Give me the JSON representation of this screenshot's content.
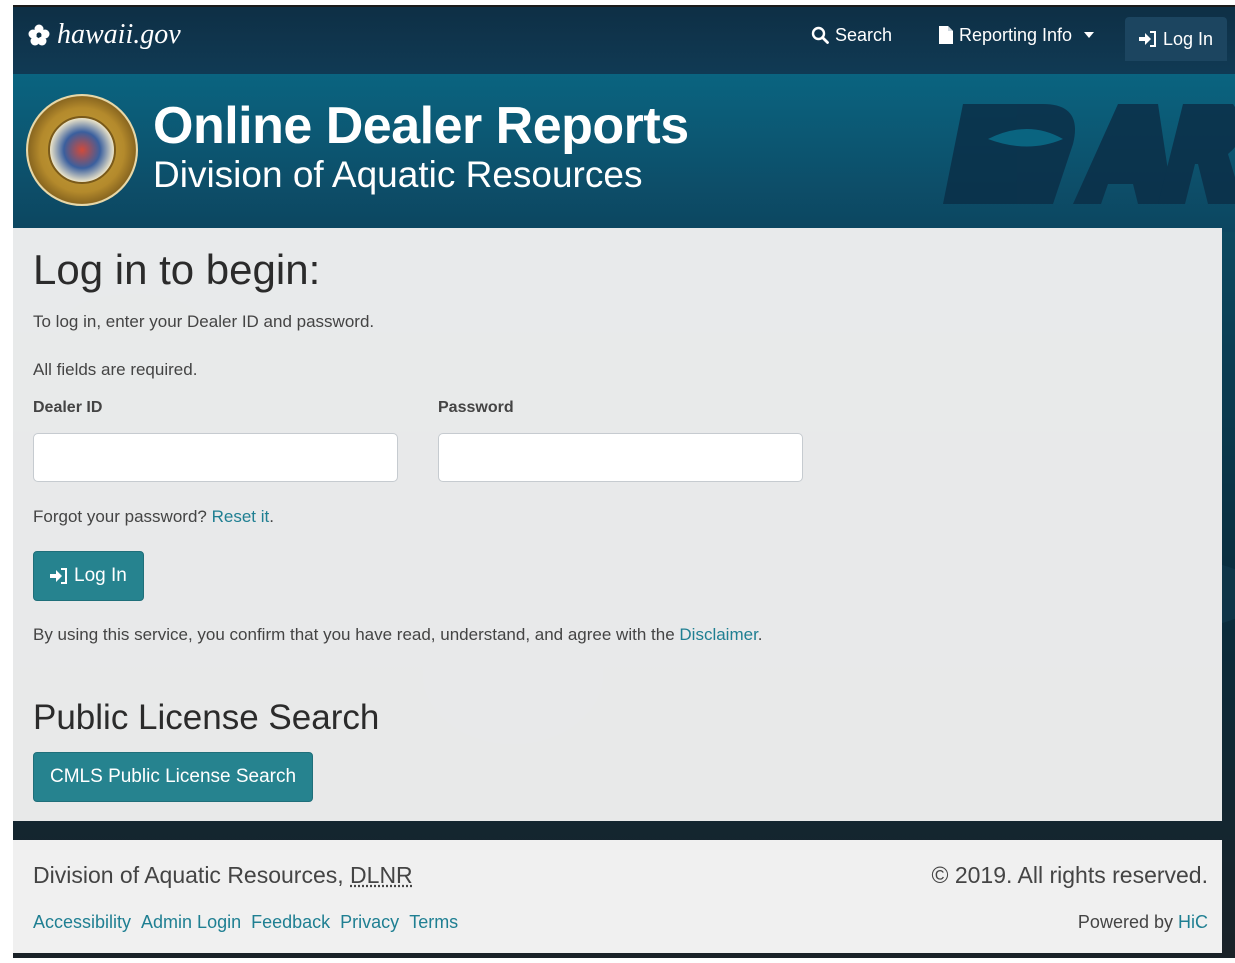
{
  "navbar": {
    "brand": "hawaii.gov",
    "search_label": "Search",
    "reporting_label": "Reporting Info",
    "login_label": "Log In"
  },
  "banner": {
    "title": "Online Dealer Reports",
    "subtitle": "Division of Aquatic Resources"
  },
  "login": {
    "heading": "Log in to begin:",
    "instructions": "To log in, enter your Dealer ID and password.",
    "required_note": "All fields are required.",
    "dealer_id_label": "Dealer ID",
    "dealer_id_value": "",
    "password_label": "Password",
    "password_value": "",
    "forgot_text": "Forgot your password?",
    "reset_link": "Reset it",
    "forgot_suffix": ".",
    "button_label": "Log In",
    "disclaimer_prefix": "By using this service, you confirm that you have read, understand, and agree with the",
    "disclaimer_link": "Disclaimer",
    "disclaimer_suffix": "."
  },
  "public_search": {
    "heading": "Public License Search",
    "button_label": "CMLS Public License Search"
  },
  "footer": {
    "org_prefix": "Division of Aquatic Resources,",
    "org_abbr": "DLNR",
    "copyright": "© 2019. All rights reserved.",
    "links": [
      "Accessibility",
      "Admin Login",
      "Feedback",
      "Privacy",
      "Terms"
    ],
    "powered_prefix": "Powered by",
    "powered_link": "HiC"
  },
  "colors": {
    "navbar": "#0e2f45",
    "banner": "#0a6480",
    "accent_button": "#26838f",
    "link": "#1f7f92"
  }
}
